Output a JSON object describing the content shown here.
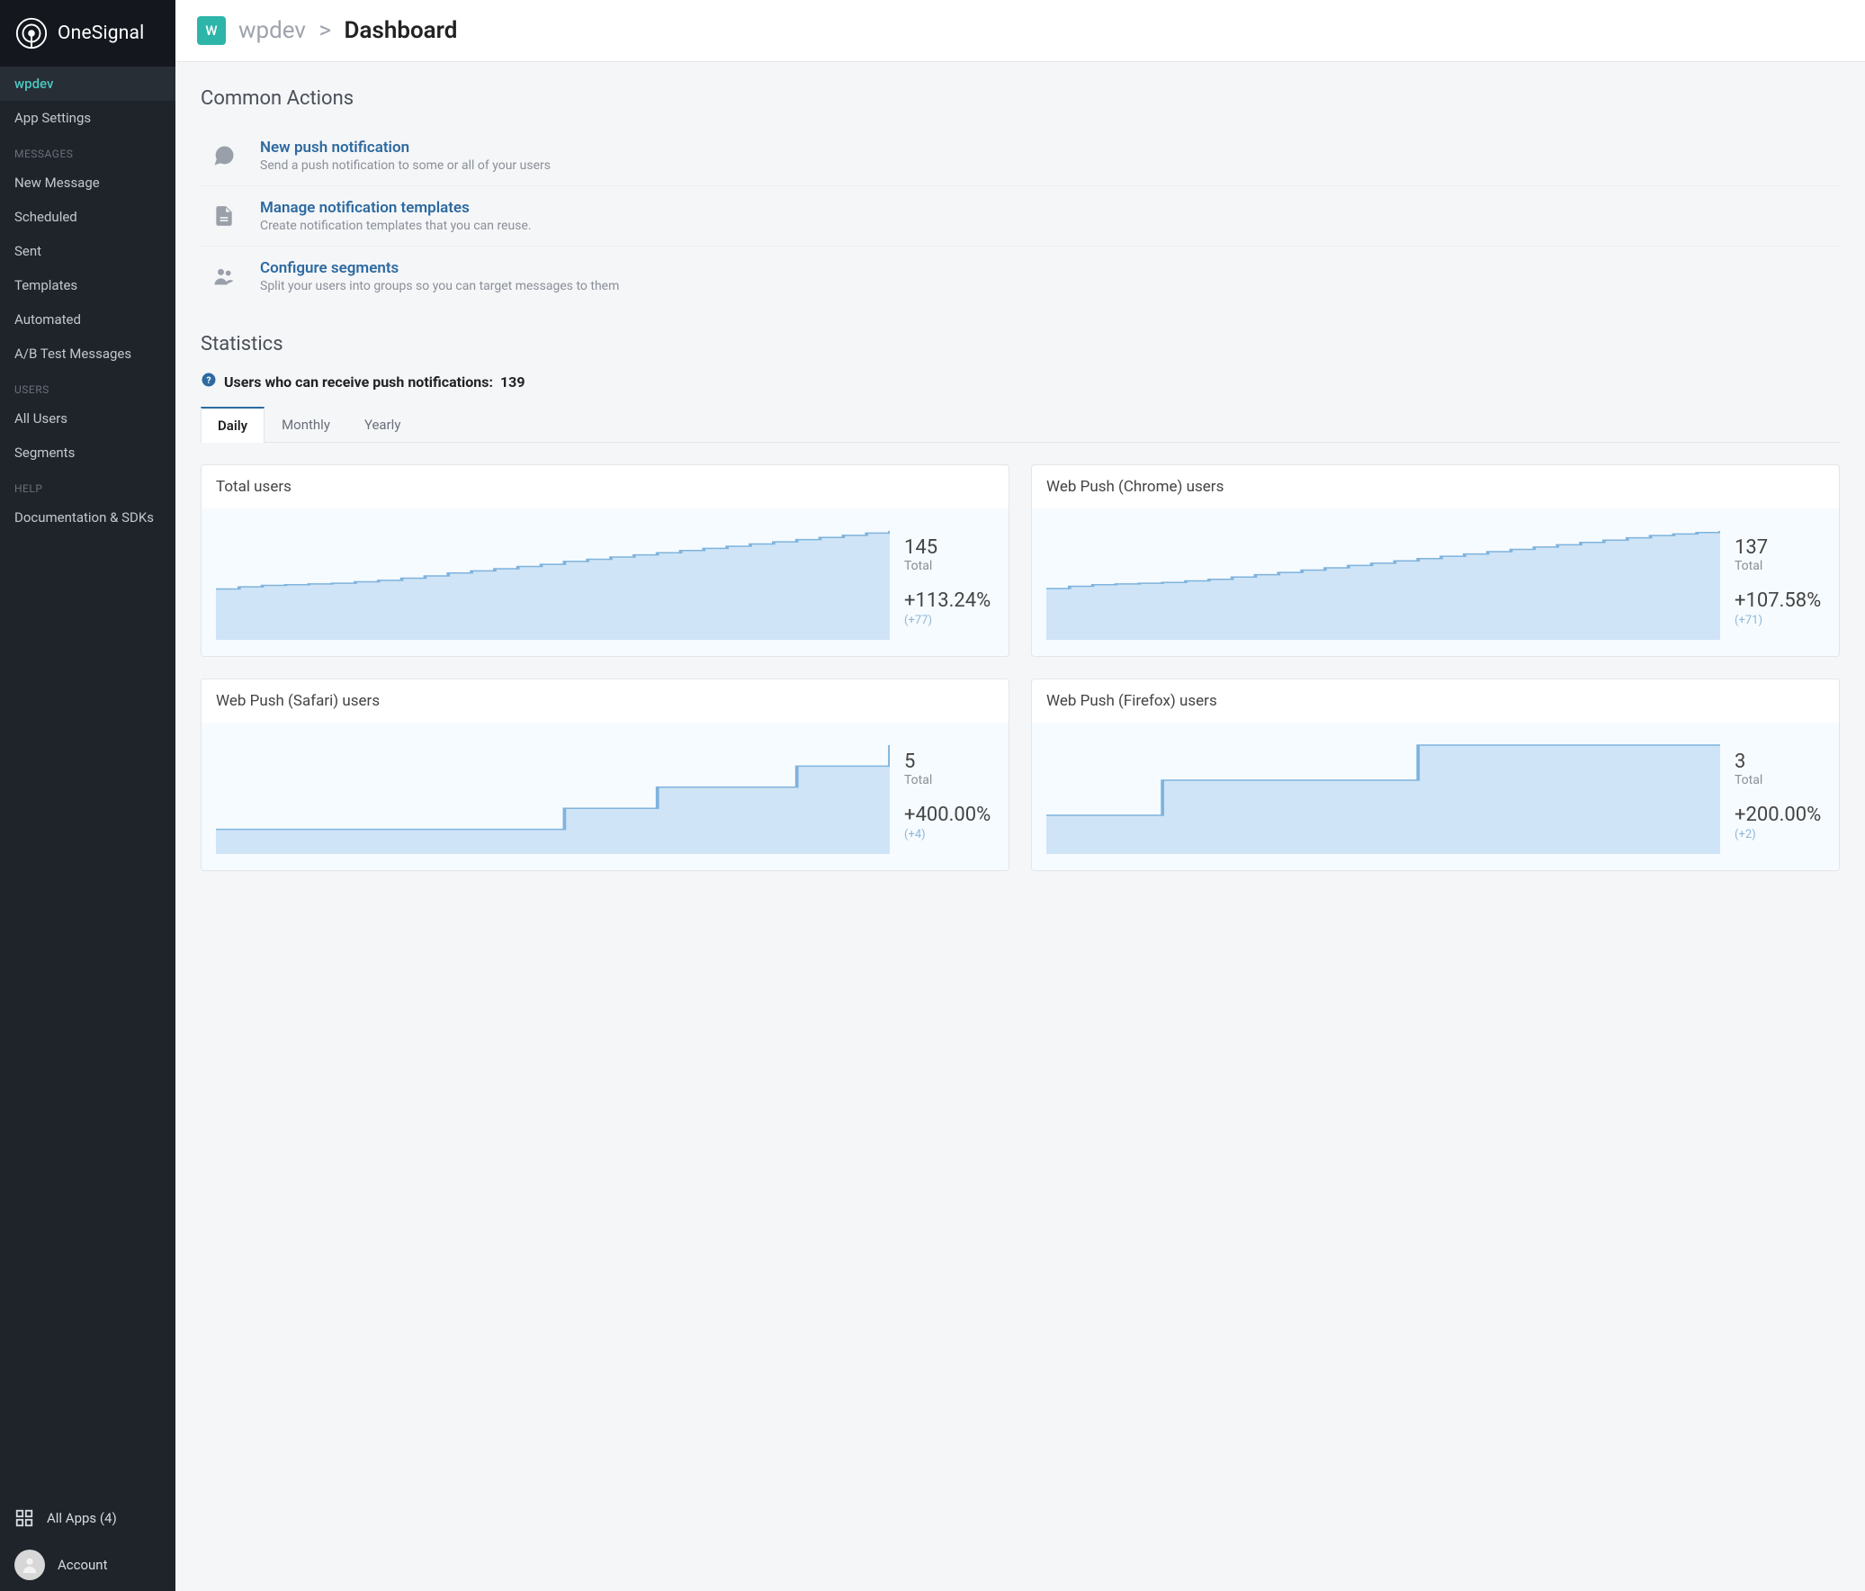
{
  "brand": "OneSignal",
  "sidebar": {
    "active_app": "wpdev",
    "settings_label": "App Settings",
    "section_messages": "MESSAGES",
    "messages": [
      "New Message",
      "Scheduled",
      "Sent",
      "Templates",
      "Automated",
      "A/B Test Messages"
    ],
    "section_users": "USERS",
    "users": [
      "All Users",
      "Segments"
    ],
    "section_help": "HELP",
    "help": [
      "Documentation & SDKs"
    ],
    "all_apps_label": "All Apps (4)",
    "account_label": "Account"
  },
  "breadcrumb": {
    "app": "wpdev",
    "current": "Dashboard",
    "badge_letter": "W"
  },
  "common_actions": {
    "title": "Common Actions",
    "items": [
      {
        "title": "New push notification",
        "desc": "Send a push notification to some or all of your users",
        "icon": "comment"
      },
      {
        "title": "Manage notification templates",
        "desc": "Create notification templates that you can reuse.",
        "icon": "file"
      },
      {
        "title": "Configure segments",
        "desc": "Split your users into groups so you can target messages to them",
        "icon": "users"
      }
    ]
  },
  "statistics": {
    "title": "Statistics",
    "subscribable_label": "Users who can receive push notifications:",
    "subscribable_count": "139",
    "tabs": [
      "Daily",
      "Monthly",
      "Yearly"
    ],
    "active_tab": "Daily",
    "cards": [
      {
        "title": "Total users",
        "value": "145",
        "label": "Total",
        "pct": "+113.24%",
        "delta": "(+77)"
      },
      {
        "title": "Web Push (Chrome) users",
        "value": "137",
        "label": "Total",
        "pct": "+107.58%",
        "delta": "(+71)"
      },
      {
        "title": "Web Push (Safari) users",
        "value": "5",
        "label": "Total",
        "pct": "+400.00%",
        "delta": "(+4)"
      },
      {
        "title": "Web Push (Firefox) users",
        "value": "3",
        "label": "Total",
        "pct": "+200.00%",
        "delta": "(+2)"
      }
    ]
  },
  "chart_data": [
    {
      "type": "area",
      "title": "Total users",
      "ylim": [
        0,
        145
      ],
      "series": [
        {
          "name": "Total users",
          "values": [
            65,
            68,
            70,
            71,
            72,
            73,
            75,
            77,
            80,
            83,
            87,
            90,
            93,
            96,
            99,
            103,
            106,
            109,
            112,
            115,
            118,
            121,
            124,
            127,
            130,
            133,
            136,
            139,
            142,
            145
          ]
        }
      ]
    },
    {
      "type": "area",
      "title": "Web Push (Chrome) users",
      "ylim": [
        0,
        137
      ],
      "series": [
        {
          "name": "Chrome users",
          "values": [
            62,
            65,
            67,
            68,
            69,
            70,
            72,
            74,
            77,
            80,
            83,
            86,
            89,
            92,
            95,
            98,
            101,
            104,
            107,
            110,
            113,
            116,
            119,
            122,
            125,
            128,
            131,
            133,
            135,
            137
          ]
        }
      ]
    },
    {
      "type": "area",
      "title": "Web Push (Safari) users",
      "ylim": [
        0,
        5
      ],
      "series": [
        {
          "name": "Safari users",
          "values": [
            1,
            1,
            1,
            1,
            1,
            1,
            1,
            1,
            1,
            1,
            1,
            1,
            1,
            1,
            1,
            2,
            2,
            2,
            2,
            3,
            3,
            3,
            3,
            3,
            3,
            4,
            4,
            4,
            4,
            5
          ]
        }
      ]
    },
    {
      "type": "area",
      "title": "Web Push (Firefox) users",
      "ylim": [
        0,
        3
      ],
      "series": [
        {
          "name": "Firefox users",
          "values": [
            1,
            1,
            1,
            1,
            1,
            2,
            2,
            2,
            2,
            2,
            2,
            2,
            2,
            2,
            2,
            2,
            3,
            3,
            3,
            3,
            3,
            3,
            3,
            3,
            3,
            3,
            3,
            3,
            3,
            3
          ]
        }
      ]
    }
  ]
}
